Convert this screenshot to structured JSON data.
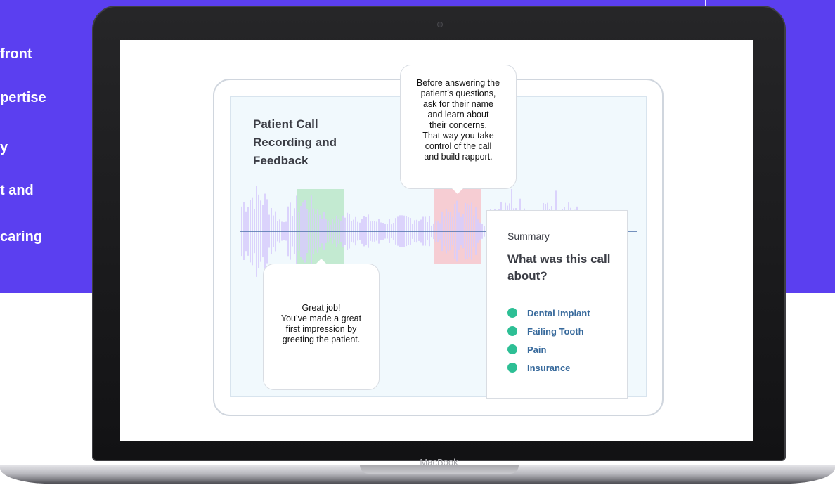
{
  "side_panel": {
    "lines": [
      "front",
      "ᵃ",
      "pertise",
      "",
      "y",
      "t and",
      "",
      "caring"
    ]
  },
  "laptop": {
    "brand": "MacBook"
  },
  "screen": {
    "panel_title": "Patient Call\nRecording and\nFeedback",
    "tip_top": "Before answering the\npatient’s questions,\nask for their name\nand learn about\ntheir concerns.\nThat way you take\ncontrol of the call\nand build rapport.",
    "tip_bottom": "Great job!\nYou’ve made a great\nfirst impression by\ngreeting the patient.",
    "summary": {
      "label": "Summary",
      "question": "What was this call about?",
      "topics": [
        "Dental Implant",
        "Failing Tooth",
        "Pain",
        "Insurance"
      ]
    }
  },
  "colors": {
    "brand_purple": "#5b3ff0",
    "good_highlight": "#b8e6c6",
    "bad_highlight": "#f6c8ce",
    "wave": "#d7cdfb",
    "timeline": "#4a6fa8",
    "topic_dot": "#2dbf95",
    "topic_text": "#386a9c"
  }
}
